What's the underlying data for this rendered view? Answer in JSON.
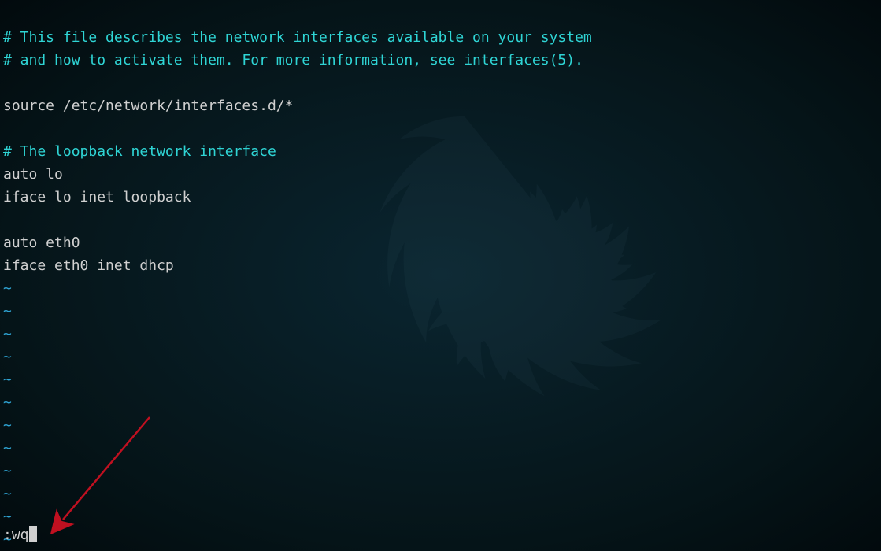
{
  "file_content": {
    "comment1": "# This file describes the network interfaces available on your system",
    "comment2": "# and how to activate them. For more information, see interfaces(5).",
    "blank1": "",
    "source_line": "source /etc/network/interfaces.d/*",
    "blank2": "",
    "comment3": "# The loopback network interface",
    "auto_lo": "auto lo",
    "iface_lo": "iface lo inet loopback",
    "blank3": "",
    "auto_eth0": "auto eth0",
    "iface_eth0": "iface eth0 inet dhcp"
  },
  "tilde": "~",
  "command": ":wq",
  "colors": {
    "comment": "#2fd5d5",
    "normal": "#d0d0d0",
    "tilde": "#2fa5d5"
  }
}
